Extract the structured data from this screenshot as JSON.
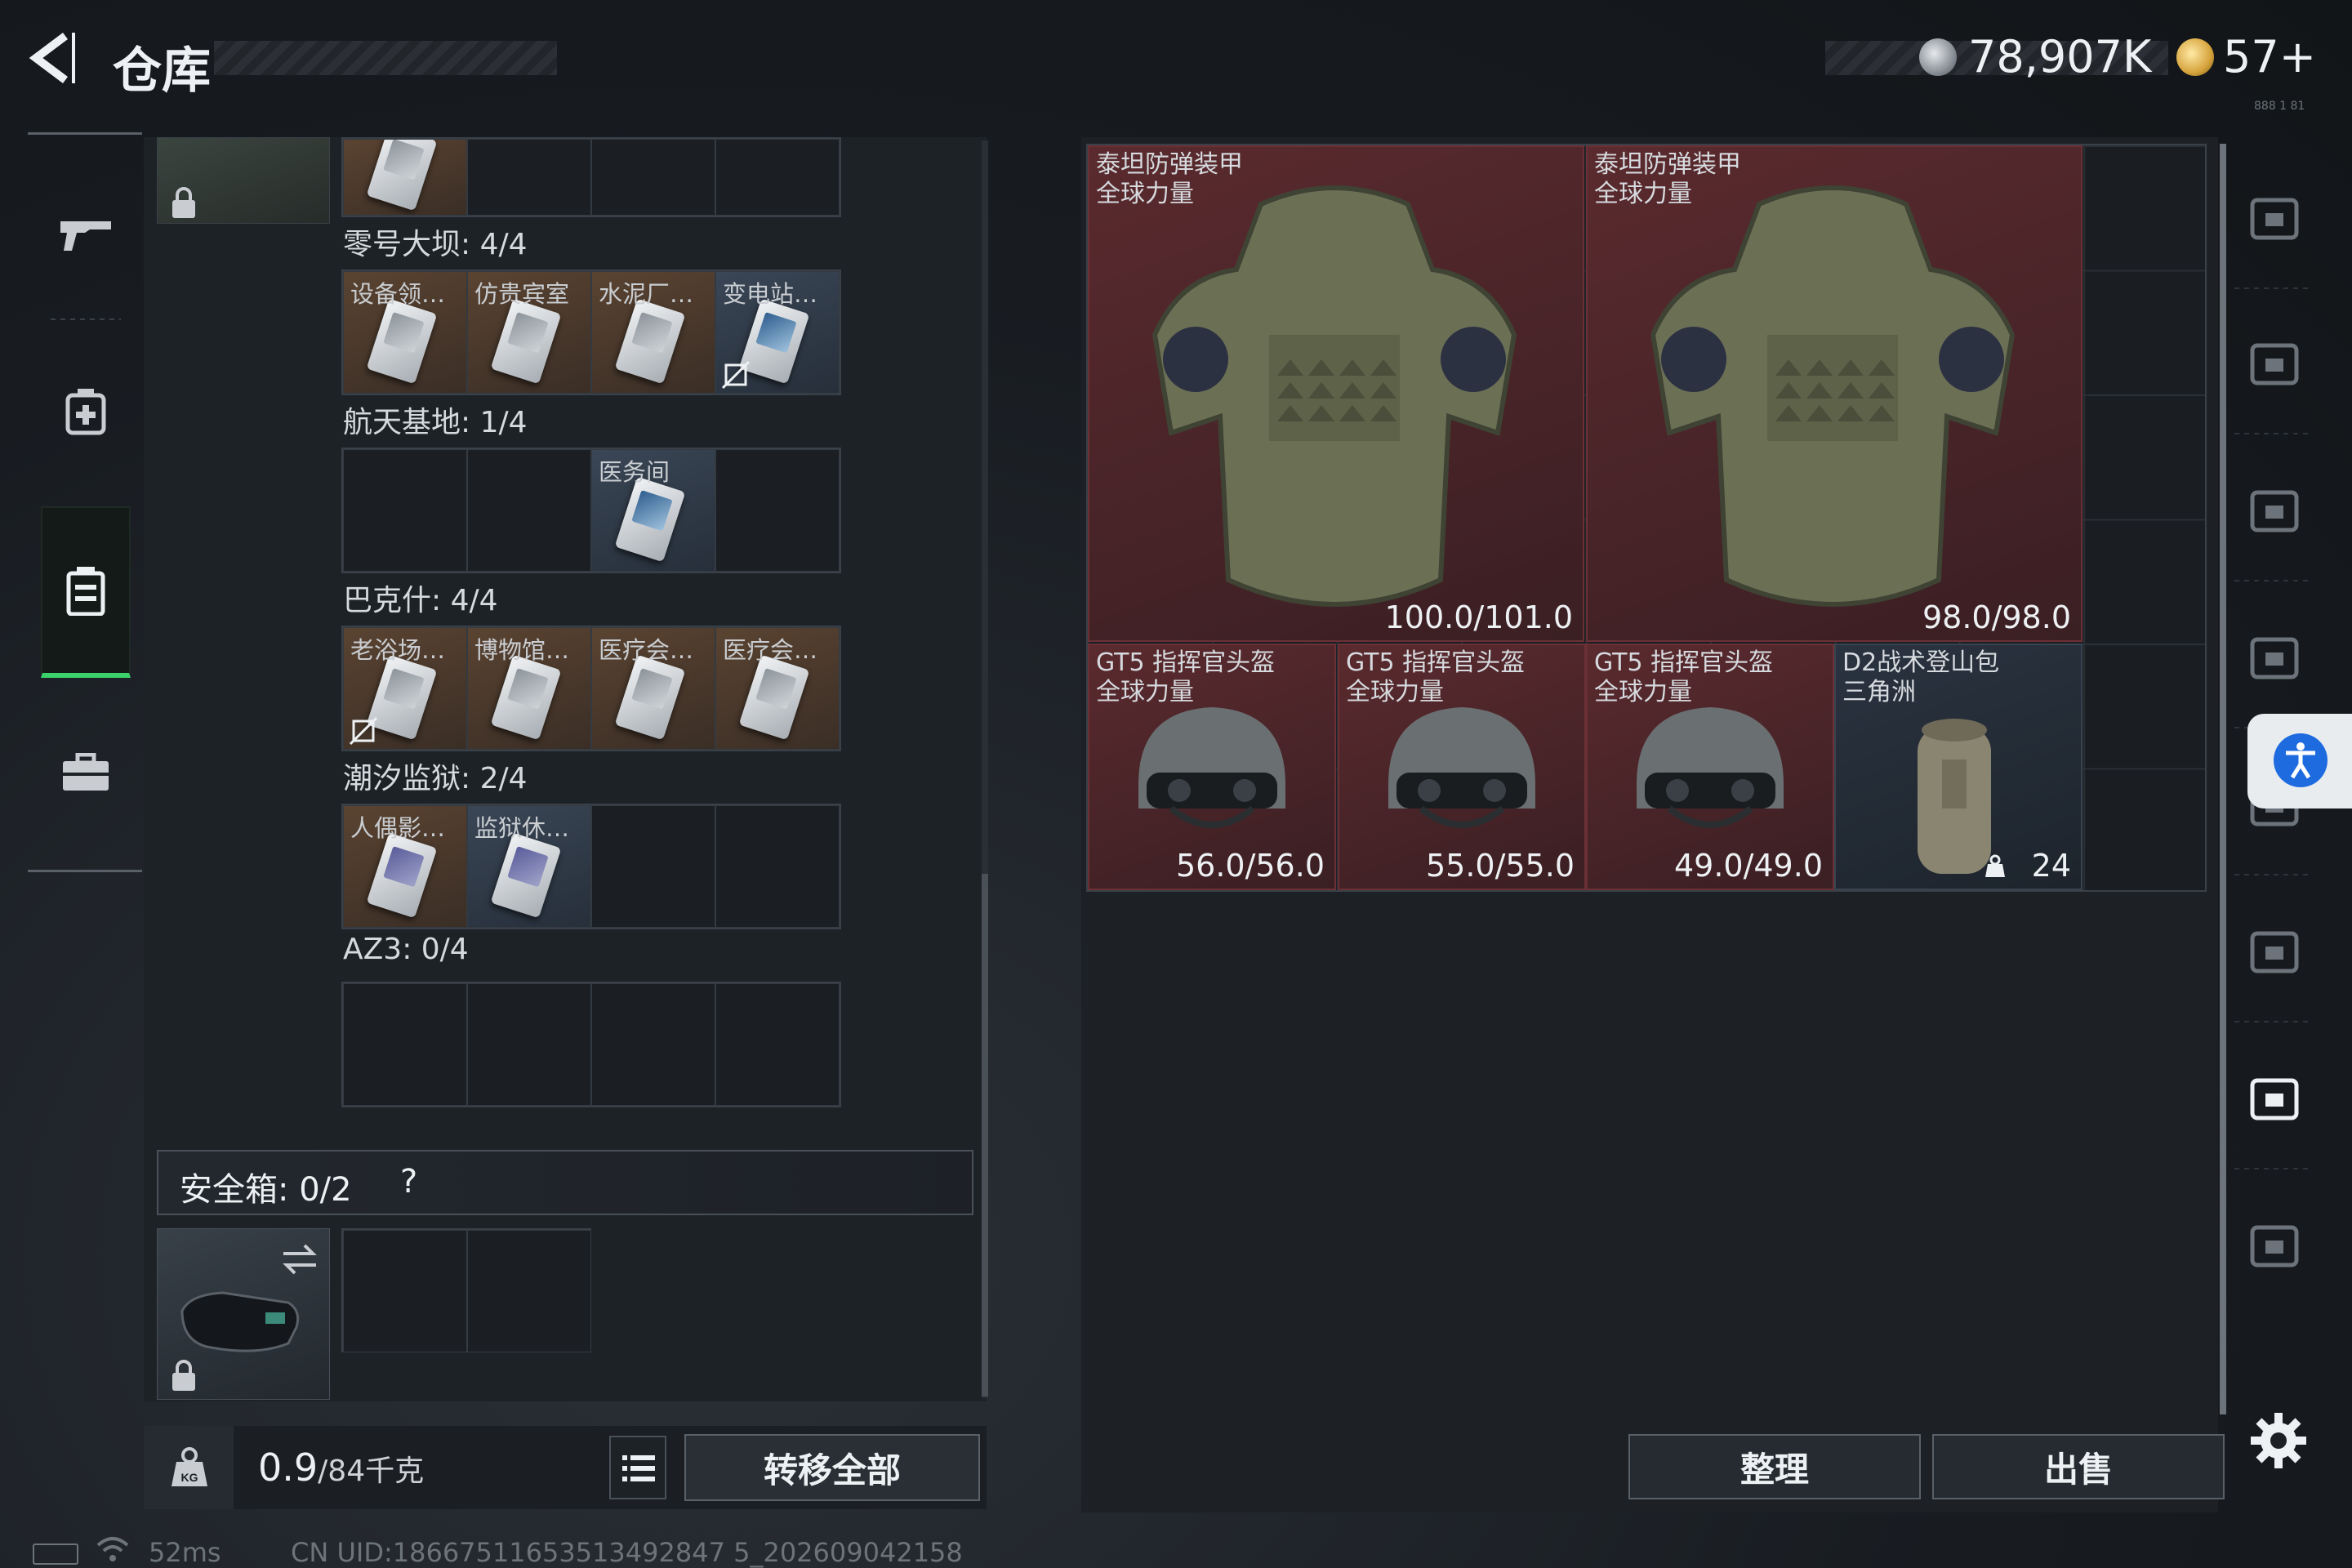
{
  "header": {
    "title": "仓库",
    "currency1": "78,907K",
    "currency2": "57+",
    "tiny": "888 1 81"
  },
  "left_rail": {
    "items": [
      "gun-icon",
      "medkit-icon",
      "backpack-icon",
      "briefcase-icon"
    ]
  },
  "sections": [
    {
      "label": "零号大坝: 4/4",
      "cells": [
        {
          "name": "设备领…",
          "bg": "brown"
        },
        {
          "name": "仿贵宾室",
          "bg": "brown"
        },
        {
          "name": "水泥厂…",
          "bg": "brown"
        },
        {
          "name": "变电站…",
          "bg": "blue",
          "nocard": true
        }
      ]
    },
    {
      "label": "航天基地: 1/4",
      "cells": [
        {
          "name": "",
          "bg": "empty"
        },
        {
          "name": "",
          "bg": "empty"
        },
        {
          "name": "医务间",
          "bg": "blue"
        },
        {
          "name": "",
          "bg": "empty"
        }
      ]
    },
    {
      "label": "巴克什: 4/4",
      "cells": [
        {
          "name": "老浴场…",
          "bg": "brown",
          "nocard": true
        },
        {
          "name": "博物馆…",
          "bg": "brown"
        },
        {
          "name": "医疗会…",
          "bg": "brown"
        },
        {
          "name": "医疗会…",
          "bg": "brown"
        }
      ]
    },
    {
      "label": "潮汐监狱: 2/4",
      "cells": [
        {
          "name": "人偶影…",
          "bg": "brown"
        },
        {
          "name": "监狱休…",
          "bg": "blue"
        },
        {
          "name": "",
          "bg": "empty"
        },
        {
          "name": "",
          "bg": "empty"
        }
      ]
    },
    {
      "label": "AZ3: 0/4",
      "cells": [
        {
          "name": "",
          "bg": "empty"
        },
        {
          "name": "",
          "bg": "empty"
        },
        {
          "name": "",
          "bg": "empty"
        },
        {
          "name": "",
          "bg": "empty"
        }
      ]
    }
  ],
  "safe": {
    "label": "安全箱: 0/2",
    "help": "?"
  },
  "weight": {
    "current": "0.9",
    "max": "/84千克"
  },
  "buttons": {
    "transfer": "转移全部",
    "sort": "整理",
    "sell": "出售"
  },
  "status": {
    "ping": "52ms",
    "uid": "CN UID:18667511653513492847 5_202609042158"
  },
  "stash_items": [
    {
      "name": "泰坦防弹装甲",
      "sub": "全球力量",
      "dur": "100.0/101.0",
      "type": "armor"
    },
    {
      "name": "泰坦防弹装甲",
      "sub": "全球力量",
      "dur": "98.0/98.0",
      "type": "armor"
    },
    {
      "name": "GT5 指挥官头盔",
      "sub": "全球力量",
      "dur": "56.0/56.0",
      "type": "helmet"
    },
    {
      "name": "GT5 指挥官头盔",
      "sub": "全球力量",
      "dur": "55.0/55.0",
      "type": "helmet"
    },
    {
      "name": "GT5 指挥官头盔",
      "sub": "全球力量",
      "dur": "49.0/49.0",
      "type": "helmet"
    },
    {
      "name": "D2战术登山包",
      "sub": "三角洲",
      "dur": "24",
      "type": "pack"
    }
  ],
  "colors": {
    "accent_green": "#3bd26b",
    "item_red": "#5a2a2e",
    "access_blue": "#1e6be0"
  }
}
